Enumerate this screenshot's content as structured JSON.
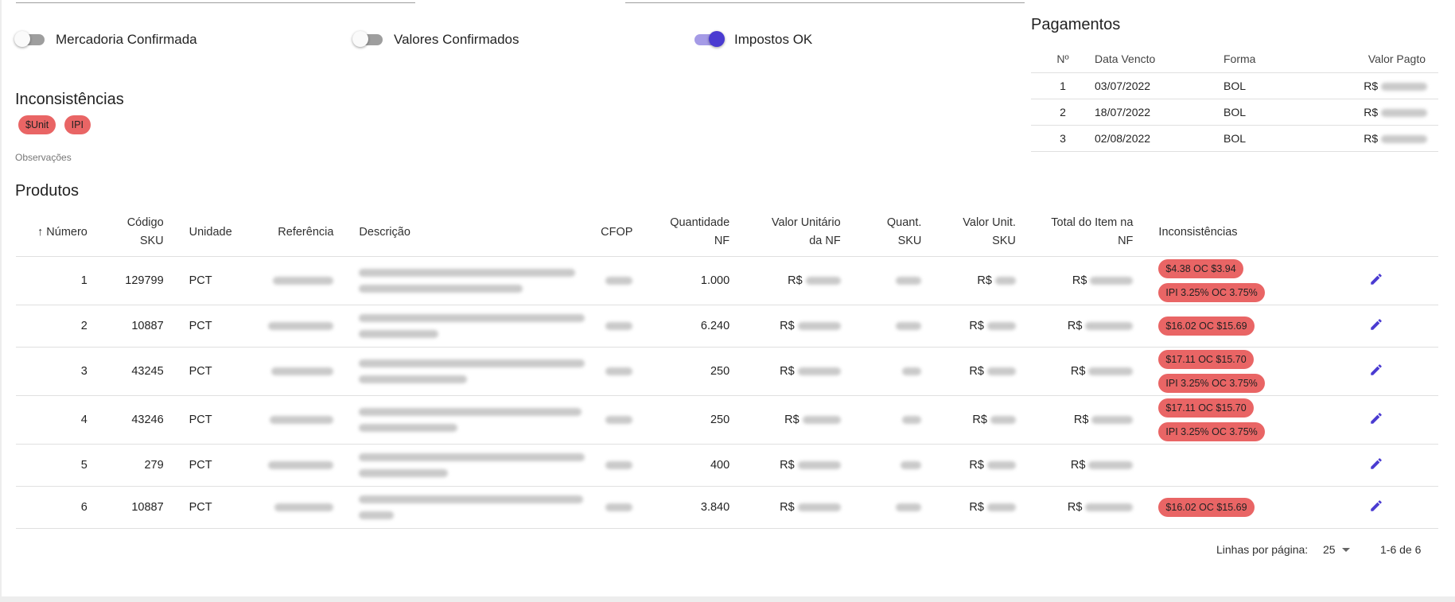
{
  "switches": [
    {
      "label": "Mercadoria Confirmada",
      "on": false
    },
    {
      "label": "Valores Confirmados",
      "on": false
    },
    {
      "label": "Impostos OK",
      "on": true
    }
  ],
  "inconsistencias": {
    "title": "Inconsistências",
    "chips": [
      "$Unit",
      "IPI"
    ],
    "observacoes_label": "Observações"
  },
  "pagamentos": {
    "title": "Pagamentos",
    "headers": [
      "Nº",
      "Data Vencto",
      "Forma",
      "Valor Pagto"
    ],
    "rows": [
      {
        "n": "1",
        "data": "03/07/2022",
        "forma": "BOL",
        "valor_prefix": "R$"
      },
      {
        "n": "2",
        "data": "18/07/2022",
        "forma": "BOL",
        "valor_prefix": "R$"
      },
      {
        "n": "3",
        "data": "02/08/2022",
        "forma": "BOL",
        "valor_prefix": "R$"
      }
    ]
  },
  "produtos": {
    "title": "Produtos",
    "headers": {
      "numero": "Número",
      "codigo_sku_1": "Código",
      "codigo_sku_2": "SKU",
      "unidade": "Unidade",
      "referencia": "Referência",
      "descricao": "Descrição",
      "cfop": "CFOP",
      "quantidade_1": "Quantidade",
      "quantidade_2": "NF",
      "valor_unit_nf_1": "Valor Unitário",
      "valor_unit_nf_2": "da NF",
      "quant_sku_1": "Quant.",
      "quant_sku_2": "SKU",
      "valor_unit_sku_1": "Valor Unit.",
      "valor_unit_sku_2": "SKU",
      "total_1": "Total do Item na",
      "total_2": "NF",
      "inconsistencias": "Inconsistências"
    },
    "currency": "R$",
    "rows": [
      {
        "numero": "1",
        "sku": "129799",
        "unidade": "PCT",
        "quantidade": "1.000",
        "inconsistencias": [
          "$4.38 OC $3.94",
          "IPI 3.25% OC 3.75%"
        ]
      },
      {
        "numero": "2",
        "sku": "10887",
        "unidade": "PCT",
        "quantidade": "6.240",
        "inconsistencias": [
          "$16.02 OC $15.69"
        ]
      },
      {
        "numero": "3",
        "sku": "43245",
        "unidade": "PCT",
        "quantidade": "250",
        "inconsistencias": [
          "$17.11 OC $15.70",
          "IPI 3.25% OC 3.75%"
        ]
      },
      {
        "numero": "4",
        "sku": "43246",
        "unidade": "PCT",
        "quantidade": "250",
        "inconsistencias": [
          "$17.11 OC $15.70",
          "IPI 3.25% OC 3.75%"
        ]
      },
      {
        "numero": "5",
        "sku": "279",
        "unidade": "PCT",
        "quantidade": "400",
        "inconsistencias": []
      },
      {
        "numero": "6",
        "sku": "10887",
        "unidade": "PCT",
        "quantidade": "3.840",
        "inconsistencias": [
          "$16.02 OC $15.69"
        ]
      }
    ]
  },
  "pagination": {
    "rows_per_page_label": "Linhas por página:",
    "rows_per_page": "25",
    "range": "1-6 de 6"
  },
  "colors": {
    "accent": "#4a3bd1",
    "chip": "#e96565"
  },
  "icons": {
    "sort": "arrow-up-icon",
    "edit": "pencil-icon",
    "dropdown": "caret-down-icon"
  }
}
